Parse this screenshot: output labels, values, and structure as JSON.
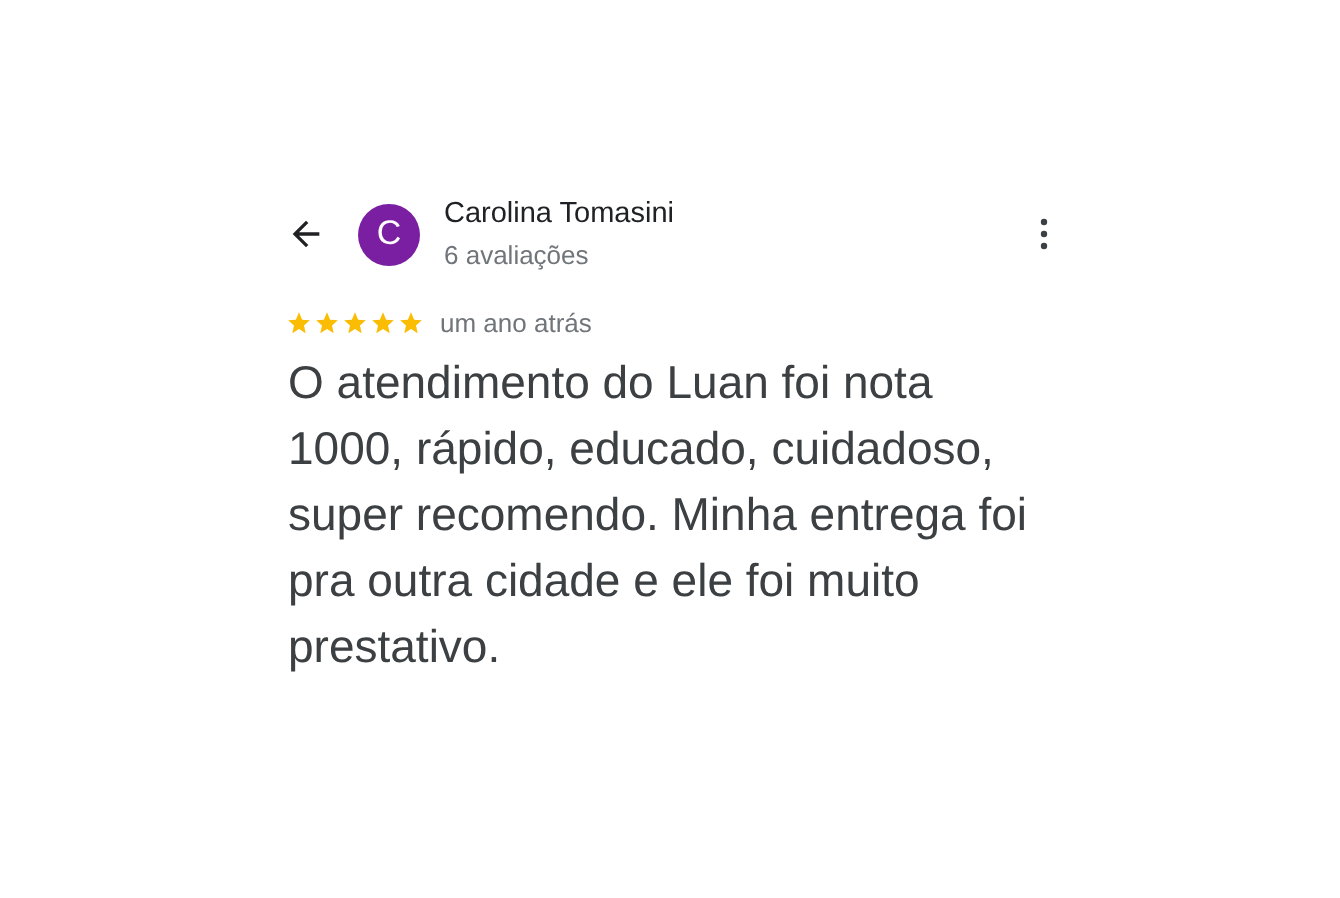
{
  "review": {
    "author": "Carolina Tomasini",
    "avatar_letter": "C",
    "review_count": "6 avaliações",
    "stars": 5,
    "time": "um ano atrás",
    "text": "O atendimento do Luan foi nota 1000, rápido, educado, cuidadoso, super recomendo. Minha entrega foi pra outra cidade e ele foi muito prestativo."
  }
}
